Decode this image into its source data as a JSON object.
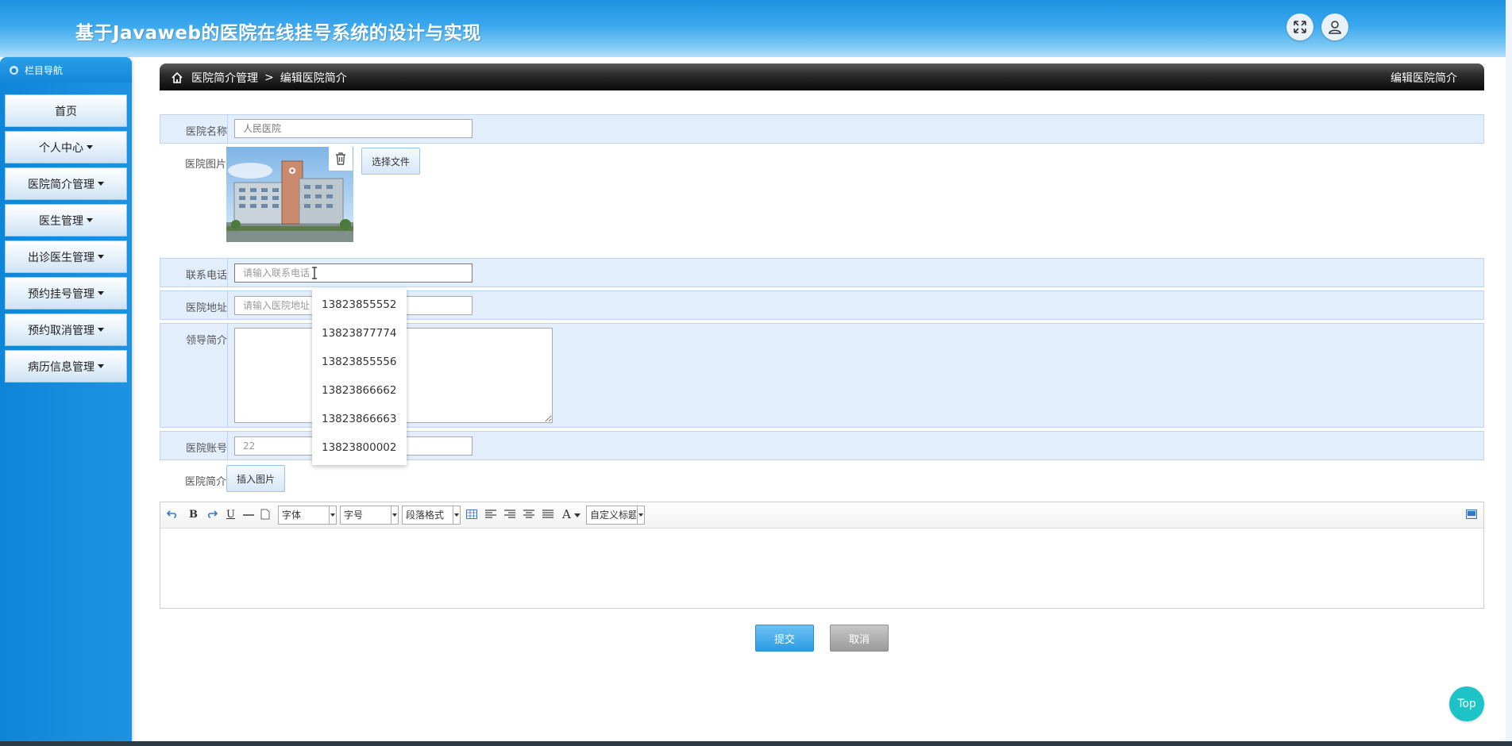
{
  "header": {
    "title": "基于Javaweb的医院在线挂号系统的设计与实现"
  },
  "sidebar": {
    "heading": "栏目导航",
    "items": [
      {
        "label": "首页",
        "dropdown": false
      },
      {
        "label": "个人中心",
        "dropdown": true
      },
      {
        "label": "医院简介管理",
        "dropdown": true
      },
      {
        "label": "医生管理",
        "dropdown": true
      },
      {
        "label": "出诊医生管理",
        "dropdown": true
      },
      {
        "label": "预约挂号管理",
        "dropdown": true
      },
      {
        "label": "预约取消管理",
        "dropdown": true
      },
      {
        "label": "病历信息管理",
        "dropdown": true
      }
    ]
  },
  "breadcrumb": {
    "section": "医院简介管理",
    "separator": ">",
    "page": "编辑医院简介",
    "right_title": "编辑医院简介"
  },
  "form": {
    "name": {
      "label": "医院名称",
      "value": "人民医院"
    },
    "image": {
      "label": "医院图片",
      "choose_file": "选择文件"
    },
    "phone": {
      "label": "联系电话",
      "placeholder": "请输入联系电话"
    },
    "address": {
      "label": "医院地址",
      "placeholder": "请输入医院地址"
    },
    "leader": {
      "label": "领导简介"
    },
    "account": {
      "label": "医院账号",
      "value": "22"
    },
    "intro": {
      "label": "医院简介",
      "insert_image": "插入图片"
    }
  },
  "autocomplete": {
    "options": [
      "13823855552",
      "13823877774",
      "13823855556",
      "13823866662",
      "13823866663",
      "13823800002"
    ]
  },
  "editor_toolbar": {
    "bold": "B",
    "underline": "U",
    "font": "字体",
    "size": "字号",
    "paragraph": "段落格式",
    "color": "A",
    "custom_title": "自定义标题"
  },
  "actions": {
    "submit": "提交",
    "cancel": "取消",
    "top": "Top"
  },
  "colors": {
    "header": "#3aa8ee",
    "sidebar": "#0e86d8",
    "band": "#e3eefc",
    "top_button": "#1cc4c8"
  }
}
